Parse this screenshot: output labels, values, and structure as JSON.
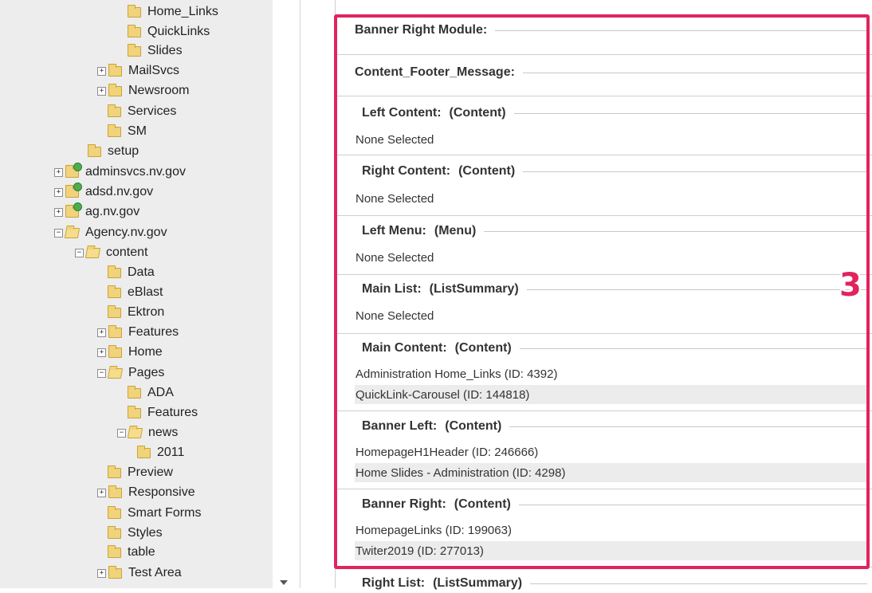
{
  "tree": {
    "items": [
      {
        "label": "Home_Links",
        "expander": "",
        "icon": "folder-icon"
      },
      {
        "label": "QuickLinks",
        "expander": "",
        "icon": "folder-icon"
      },
      {
        "label": "Slides",
        "expander": "",
        "icon": "folder-icon"
      },
      {
        "label": "MailSvcs",
        "expander": "+",
        "icon": "folder-icon"
      },
      {
        "label": "Newsroom",
        "expander": "+",
        "icon": "folder-icon"
      },
      {
        "label": "Services",
        "expander": "",
        "icon": "folder-icon"
      },
      {
        "label": "SM",
        "expander": "",
        "icon": "folder-icon"
      },
      {
        "label": "setup",
        "expander": "",
        "icon": "folder-icon"
      },
      {
        "label": "adminsvcs.nv.gov",
        "expander": "+",
        "icon": "site-folder-icon"
      },
      {
        "label": "adsd.nv.gov",
        "expander": "+",
        "icon": "site-folder-icon"
      },
      {
        "label": "ag.nv.gov",
        "expander": "+",
        "icon": "site-folder-icon"
      },
      {
        "label": "Agency.nv.gov",
        "expander": "−",
        "icon": "open-folder-icon"
      },
      {
        "label": "content",
        "expander": "−",
        "icon": "open-folder-icon"
      },
      {
        "label": "Data",
        "expander": "",
        "icon": "folder-icon"
      },
      {
        "label": "eBlast",
        "expander": "",
        "icon": "folder-icon"
      },
      {
        "label": "Ektron",
        "expander": "",
        "icon": "folder-icon"
      },
      {
        "label": "Features",
        "expander": "+",
        "icon": "folder-icon"
      },
      {
        "label": "Home",
        "expander": "+",
        "icon": "folder-icon"
      },
      {
        "label": "Pages",
        "expander": "−",
        "icon": "open-folder-icon"
      },
      {
        "label": "ADA",
        "expander": "",
        "icon": "folder-icon"
      },
      {
        "label": "Features",
        "expander": "",
        "icon": "folder-icon"
      },
      {
        "label": "news",
        "expander": "−",
        "icon": "open-folder-icon"
      },
      {
        "label": "2011",
        "expander": "",
        "icon": "folder-icon"
      },
      {
        "label": "Preview",
        "expander": "",
        "icon": "folder-icon"
      },
      {
        "label": "Responsive",
        "expander": "+",
        "icon": "folder-icon"
      },
      {
        "label": "Smart Forms",
        "expander": "",
        "icon": "folder-icon"
      },
      {
        "label": "Styles",
        "expander": "",
        "icon": "folder-icon"
      },
      {
        "label": "table",
        "expander": "",
        "icon": "folder-icon"
      },
      {
        "label": "Test Area",
        "expander": "+",
        "icon": "folder-icon"
      }
    ]
  },
  "sections": [
    {
      "title": "Banner Right Module:",
      "type": "",
      "rows": []
    },
    {
      "title": "Content_Footer_Message:",
      "type": "",
      "rows": []
    },
    {
      "title": "Left Content:",
      "type": "(Content)",
      "rows": [
        "None Selected"
      ]
    },
    {
      "title": "Right Content:",
      "type": "(Content)",
      "rows": [
        "None Selected"
      ]
    },
    {
      "title": "Left Menu:",
      "type": "(Menu)",
      "rows": [
        "None Selected"
      ]
    },
    {
      "title": "Main List:",
      "type": "(ListSummary)",
      "rows": [
        "None Selected"
      ]
    },
    {
      "title": "Main Content:",
      "type": "(Content)",
      "rows": [
        "Administration Home_Links  (ID: 4392)",
        "QuickLink-Carousel  (ID: 144818)"
      ]
    },
    {
      "title": "Banner Left:",
      "type": "(Content)",
      "rows": [
        "HomepageH1Header  (ID: 246666)",
        "Home Slides - Administration  (ID: 4298)"
      ]
    },
    {
      "title": "Banner Right:",
      "type": "(Content)",
      "rows": [
        "HomepageLinks  (ID: 199063)",
        "Twiter2019  (ID: 277013)"
      ]
    },
    {
      "title": "Right List:",
      "type": "(ListSummary)",
      "rows": []
    }
  ],
  "annotation": {
    "badge": "3",
    "color": "#e0245e"
  }
}
